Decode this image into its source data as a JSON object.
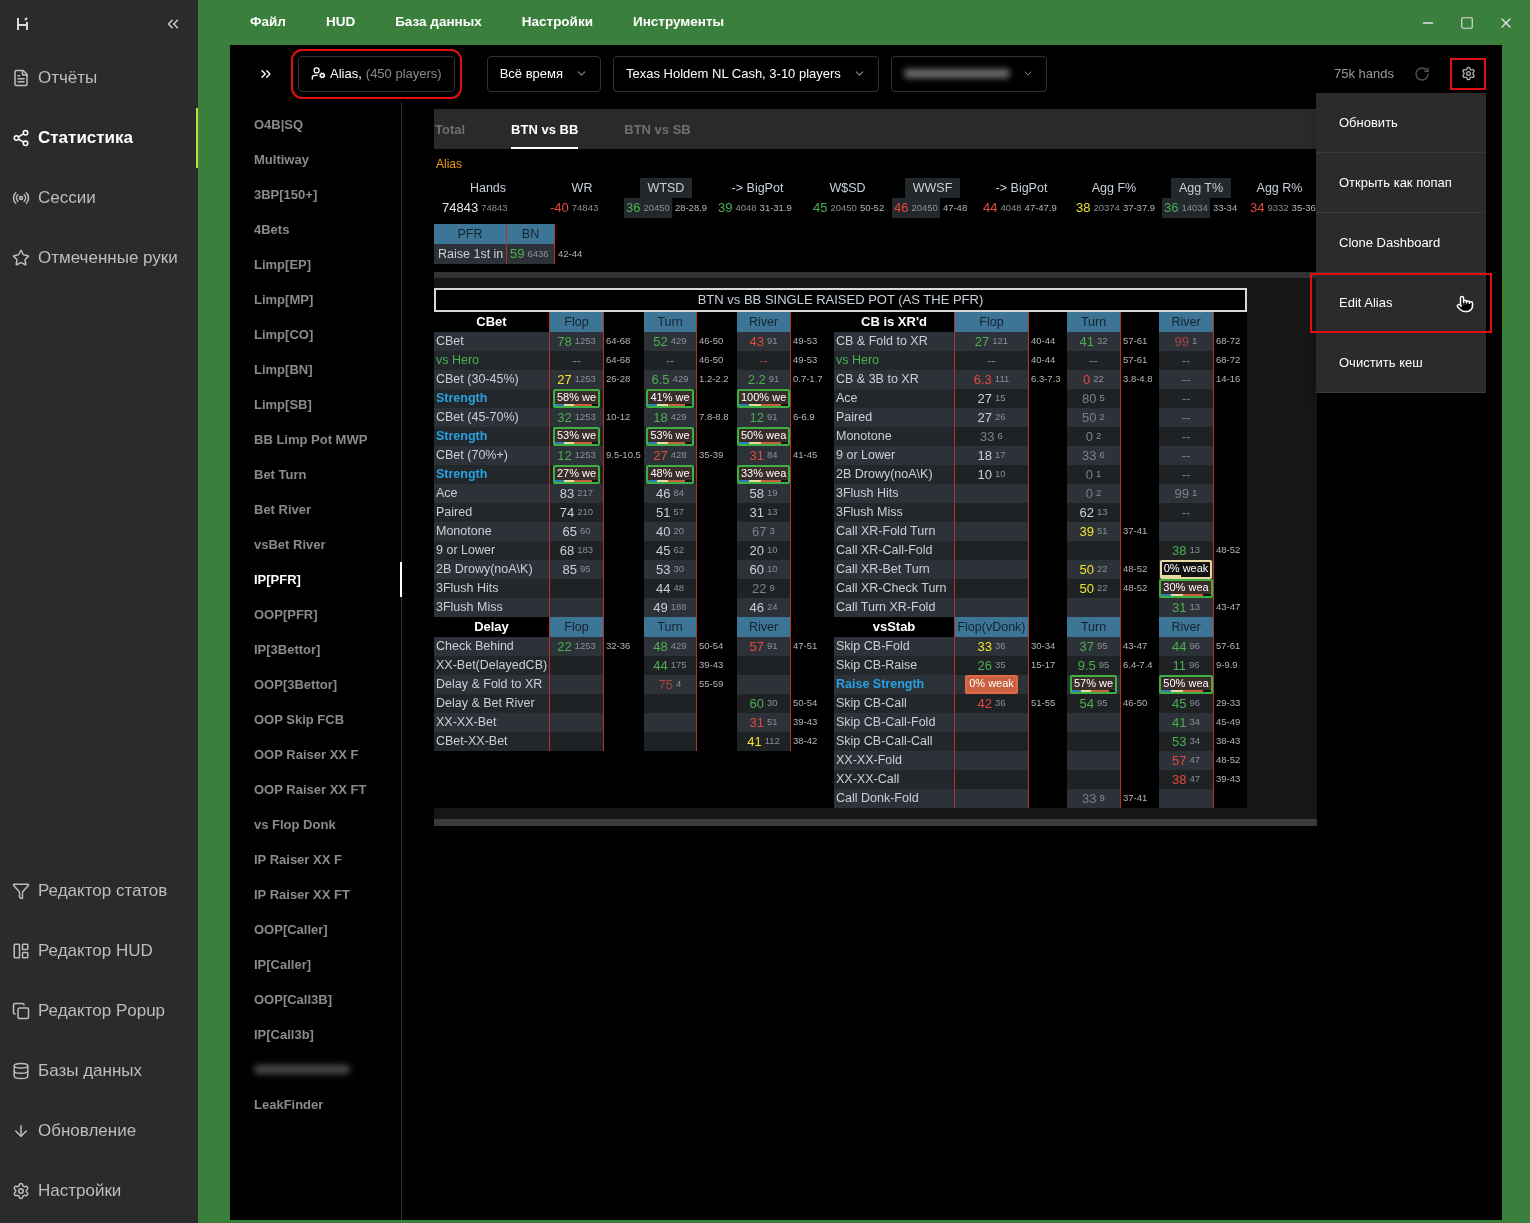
{
  "sidebar": {
    "top_items": [
      {
        "label": "Отчёты",
        "selected": false
      },
      {
        "label": "Статистика",
        "selected": true
      },
      {
        "label": "Сессии",
        "selected": false
      },
      {
        "label": "Отмеченные руки",
        "selected": false
      }
    ],
    "bottom_items": [
      {
        "label": "Редактор статов",
        "selected": false
      },
      {
        "label": "Редактор HUD",
        "selected": false
      },
      {
        "label": "Редактор Popup",
        "selected": false
      },
      {
        "label": "Базы данных",
        "selected": false
      },
      {
        "label": "Обновление",
        "selected": false
      },
      {
        "label": "Настройки",
        "selected": false
      }
    ]
  },
  "menu_bar": [
    "Файл",
    "HUD",
    "База данных",
    "Настройки",
    "Инструменты"
  ],
  "toolbar": {
    "alias_button": {
      "label": "Alias,",
      "count": "(450 players)",
      "highlighted": true
    },
    "dropdowns": [
      {
        "kind": "text",
        "value": "Всё время"
      },
      {
        "kind": "text",
        "value": "Texas Holdem NL Cash, 3-10 players"
      },
      {
        "kind": "blurred"
      }
    ],
    "hands": "75k hands",
    "settings_highlighted": true
  },
  "report_list": [
    {
      "kind": "text",
      "label": "O4B|SQ",
      "selected": false
    },
    {
      "kind": "text",
      "label": "Multiway",
      "selected": false
    },
    {
      "kind": "text",
      "label": "3BP[150+]",
      "selected": false
    },
    {
      "kind": "text",
      "label": "4Bets",
      "selected": false
    },
    {
      "kind": "text",
      "label": "Limp[EP]",
      "selected": false
    },
    {
      "kind": "text",
      "label": "Limp[MP]",
      "selected": false
    },
    {
      "kind": "text",
      "label": "Limp[CO]",
      "selected": false
    },
    {
      "kind": "text",
      "label": "Limp[BN]",
      "selected": false
    },
    {
      "kind": "text",
      "label": "Limp[SB]",
      "selected": false
    },
    {
      "kind": "text",
      "label": "BB Limp Pot MWP",
      "selected": false
    },
    {
      "kind": "text",
      "label": "Bet Turn",
      "selected": false
    },
    {
      "kind": "text",
      "label": "Bet River",
      "selected": false
    },
    {
      "kind": "text",
      "label": "vsBet River",
      "selected": false
    },
    {
      "kind": "text",
      "label": "IP[PFR]",
      "selected": true
    },
    {
      "kind": "text",
      "label": "OOP[PFR]",
      "selected": false
    },
    {
      "kind": "text",
      "label": "IP[3Bettor]",
      "selected": false
    },
    {
      "kind": "text",
      "label": "OOP[3Bettor]",
      "selected": false
    },
    {
      "kind": "text",
      "label": "OOP Skip FCB",
      "selected": false
    },
    {
      "kind": "text",
      "label": "OOP Raiser XX F",
      "selected": false
    },
    {
      "kind": "text",
      "label": "OOP Raiser XX FT",
      "selected": false
    },
    {
      "kind": "text",
      "label": "vs Flop Donk",
      "selected": false
    },
    {
      "kind": "text",
      "label": "IP Raiser XX F",
      "selected": false
    },
    {
      "kind": "text",
      "label": "IP Raiser XX FT",
      "selected": false
    },
    {
      "kind": "text",
      "label": "OOP[Caller]",
      "selected": false
    },
    {
      "kind": "text",
      "label": "IP[Caller]",
      "selected": false
    },
    {
      "kind": "text",
      "label": "OOP[Call3B]",
      "selected": false
    },
    {
      "kind": "text",
      "label": "IP[Call3b]",
      "selected": false
    },
    {
      "kind": "blurred",
      "selected": false
    },
    {
      "kind": "text",
      "label": "LeakFinder",
      "selected": false
    }
  ],
  "tabs": [
    {
      "label": "Total",
      "selected": false
    },
    {
      "label": "BTN vs BB",
      "selected": true
    },
    {
      "label": "BTN vs SB",
      "selected": false
    }
  ],
  "stats_header": {
    "group_label": "Alias",
    "stats": [
      {
        "name": "Hands",
        "highlighted": false,
        "v": "74843",
        "n": "74843",
        "color": "#e8e8e8"
      },
      {
        "name": "WR",
        "highlighted": false,
        "v": "-40",
        "n": "74843",
        "color": "#e5483b"
      },
      {
        "name": "WTSD",
        "highlighted": true,
        "v": "36",
        "n": "20450",
        "color": "#4caf50",
        "range": "28-28.9"
      },
      {
        "name": "-> BigPot",
        "highlighted": false,
        "v": "39",
        "n": "4048",
        "color": "#4caf50",
        "range": "31-31.9"
      },
      {
        "name": "W$SD",
        "highlighted": false,
        "v": "45",
        "n": "20450",
        "color": "#4caf50",
        "range": "50-52"
      },
      {
        "name": "WWSF",
        "highlighted": true,
        "v": "46",
        "n": "20450",
        "color": "#e5483b",
        "range": "47-48"
      },
      {
        "name": "-> BigPot",
        "highlighted": false,
        "v": "44",
        "n": "4048",
        "color": "#e5483b",
        "range": "47-47.9"
      },
      {
        "name": "Agg F%",
        "highlighted": false,
        "v": "38",
        "n": "20374",
        "color": "#f2e22a",
        "range": "37-37.9"
      },
      {
        "name": "Agg T%",
        "highlighted": true,
        "v": "36",
        "n": "14034",
        "color": "#4caf50",
        "range": "33-34"
      },
      {
        "name": "Agg R%",
        "highlighted": false,
        "v": "34",
        "n": "9332",
        "color": "#e5483b",
        "range": "35-36"
      }
    ]
  },
  "pfr_table": {
    "headers": [
      "PFR",
      "BN"
    ],
    "label": "Raise 1st in",
    "v": "59",
    "n": "6436",
    "color": "#4caf50",
    "range": "42-44"
  },
  "table": {
    "title": "BTN vs BB SINGLE RAISED POT (AS THE PFR)",
    "rows": [
      {
        "left": {
          "kind": "header",
          "title": "CBet",
          "streets": [
            "Flop",
            "Turn",
            "River"
          ]
        },
        "right": {
          "kind": "header",
          "title": "CB is XR'd",
          "streets": [
            "Flop",
            "Turn",
            "River"
          ]
        }
      },
      {
        "left": {
          "kind": "stat",
          "label": "CBet",
          "color": "#c8d0d8",
          "bold": false,
          "cells": [
            {
              "kind": "value",
              "v": "78",
              "n": "1253",
              "color": "#4caf50",
              "range": "64-68"
            },
            {
              "kind": "value",
              "v": "52",
              "n": "429",
              "color": "#4caf50",
              "range": "46-50"
            },
            {
              "kind": "value",
              "v": "43",
              "n": "91",
              "color": "#e5483b",
              "range": "49-53"
            }
          ]
        },
        "right": {
          "kind": "stat",
          "label": "CB & Fold to XR",
          "color": "#c8d0d8",
          "bold": false,
          "cells": [
            {
              "kind": "value",
              "v": "27",
              "n": "121",
              "color": "#4caf50",
              "range": "40-44"
            },
            {
              "kind": "value",
              "v": "41",
              "n": "32",
              "color": "#4caf50",
              "range": "57-61"
            },
            {
              "kind": "value",
              "v": "99",
              "n": "1",
              "color": "#a8453c",
              "range": "68-72"
            }
          ]
        }
      },
      {
        "left": {
          "kind": "stat",
          "label": "vs Hero",
          "color": "#4caf50",
          "bold": false,
          "cells": [
            {
              "kind": "value",
              "v": "--",
              "color": "#7a8187",
              "range": "64-68"
            },
            {
              "kind": "value",
              "v": "--",
              "color": "#7a8187",
              "range": "46-50"
            },
            {
              "kind": "value",
              "v": "--",
              "color": "#a8453c",
              "range": "49-53"
            }
          ]
        },
        "right": {
          "kind": "stat",
          "label": "vs Hero",
          "color": "#4caf50",
          "bold": false,
          "cells": [
            {
              "kind": "value",
              "v": "--",
              "color": "#7a8187",
              "range": "40-44"
            },
            {
              "kind": "value",
              "v": "--",
              "color": "#7a8187",
              "range": "57-61"
            },
            {
              "kind": "value",
              "v": "--",
              "color": "#7a8187",
              "range": "68-72"
            }
          ]
        }
      },
      {
        "left": {
          "kind": "stat",
          "label": "CBet (30-45%)",
          "color": "#c8d0d8",
          "bold": false,
          "cells": [
            {
              "kind": "value",
              "v": "27",
              "n": "1253",
              "color": "#f2e22a",
              "range": "26-28"
            },
            {
              "kind": "value",
              "v": "6.5",
              "n": "429",
              "color": "#4caf50",
              "range": "1.2-2.2"
            },
            {
              "kind": "value",
              "v": "2.2",
              "n": "91",
              "color": "#4caf50",
              "range": "0.7-1.7"
            }
          ]
        },
        "right": {
          "kind": "stat",
          "label": "CB & 3B to XR",
          "color": "#c8d0d8",
          "bold": false,
          "cells": [
            {
              "kind": "value",
              "v": "6.3",
              "n": "111",
              "color": "#e5483b",
              "range": "6.3-7.3"
            },
            {
              "kind": "value",
              "v": "0",
              "n": "22",
              "color": "#e5483b",
              "range": "3.8-4.8"
            },
            {
              "kind": "value",
              "v": "--",
              "color": "#7a8187",
              "range": "14-16"
            }
          ]
        }
      },
      {
        "left": {
          "kind": "stat",
          "label": "Strength",
          "color": "#2aa0e0",
          "bold": true,
          "cells": [
            {
              "kind": "striped-bar",
              "text": "58% we",
              "color": "#3cb043"
            },
            {
              "kind": "striped-bar",
              "text": "41% we",
              "color": "#3cb043"
            },
            {
              "kind": "striped-bar",
              "text": "100% we",
              "color": "#3cb043"
            }
          ]
        },
        "right": {
          "kind": "stat",
          "label": "Ace",
          "color": "#c8d0d8",
          "bold": false,
          "cells": [
            {
              "kind": "value",
              "v": "27",
              "n": "15",
              "color": "#c8d0d8"
            },
            {
              "kind": "value",
              "v": "80",
              "n": "5",
              "color": "#7a8187"
            },
            {
              "kind": "value",
              "v": "--",
              "color": "#7a8187"
            }
          ]
        }
      },
      {
        "left": {
          "kind": "stat",
          "label": "CBet (45-70%)",
          "color": "#c8d0d8",
          "bold": false,
          "cells": [
            {
              "kind": "value",
              "v": "32",
              "n": "1253",
              "color": "#4caf50",
              "range": "10-12"
            },
            {
              "kind": "value",
              "v": "18",
              "n": "429",
              "color": "#4caf50",
              "range": "7.8-8.8"
            },
            {
              "kind": "value",
              "v": "12",
              "n": "91",
              "color": "#4caf50",
              "range": "6-6.9"
            }
          ]
        },
        "right": {
          "kind": "stat",
          "label": "Paired",
          "color": "#c8d0d8",
          "bold": false,
          "cells": [
            {
              "kind": "value",
              "v": "27",
              "n": "26",
              "color": "#c8d0d8"
            },
            {
              "kind": "value",
              "v": "50",
              "n": "2",
              "color": "#7a8187"
            },
            {
              "kind": "value",
              "v": "--",
              "color": "#7a8187"
            }
          ]
        }
      },
      {
        "left": {
          "kind": "stat",
          "label": "Strength",
          "color": "#2aa0e0",
          "bold": true,
          "cells": [
            {
              "kind": "striped-bar",
              "text": "53% we",
              "color": "#3cb043"
            },
            {
              "kind": "striped-bar",
              "text": "53% we",
              "color": "#3cb043"
            },
            {
              "kind": "striped-bar",
              "text": "50% wea",
              "color": "#3cb043"
            }
          ]
        },
        "right": {
          "kind": "stat",
          "label": "Monotone",
          "color": "#c8d0d8",
          "bold": false,
          "cells": [
            {
              "kind": "value",
              "v": "33",
              "n": "6",
              "color": "#7a8187"
            },
            {
              "kind": "value",
              "v": "0",
              "n": "2",
              "color": "#7a8187"
            },
            {
              "kind": "value",
              "v": "--",
              "color": "#7a8187"
            }
          ]
        }
      },
      {
        "left": {
          "kind": "stat",
          "label": "CBet (70%+)",
          "color": "#c8d0d8",
          "bold": false,
          "cells": [
            {
              "kind": "value",
              "v": "12",
              "n": "1253",
              "color": "#4caf50",
              "range": "9.5-10.5"
            },
            {
              "kind": "value",
              "v": "27",
              "n": "428",
              "color": "#e5483b",
              "range": "35-39"
            },
            {
              "kind": "value",
              "v": "31",
              "n": "84",
              "color": "#e5483b",
              "range": "41-45"
            }
          ]
        },
        "right": {
          "kind": "stat",
          "label": "9 or Lower",
          "color": "#c8d0d8",
          "bold": false,
          "cells": [
            {
              "kind": "value",
              "v": "18",
              "n": "17",
              "color": "#c8d0d8"
            },
            {
              "kind": "value",
              "v": "33",
              "n": "6",
              "color": "#7a8187"
            },
            {
              "kind": "value",
              "v": "--",
              "color": "#7a8187"
            }
          ]
        }
      },
      {
        "left": {
          "kind": "stat",
          "label": "Strength",
          "color": "#2aa0e0",
          "bold": true,
          "cells": [
            {
              "kind": "striped-bar",
              "text": "27% we",
              "color": "#3cb043"
            },
            {
              "kind": "striped-bar",
              "text": "48% we",
              "color": "#3cb043"
            },
            {
              "kind": "striped-bar",
              "text": "33% wea",
              "color": "#3cb043"
            }
          ]
        },
        "right": {
          "kind": "stat",
          "label": "2B Drowy(noA\\K)",
          "color": "#c8d0d8",
          "bold": false,
          "cells": [
            {
              "kind": "value",
              "v": "10",
              "n": "10",
              "color": "#c8d0d8"
            },
            {
              "kind": "value",
              "v": "0",
              "n": "1",
              "color": "#7a8187"
            },
            {
              "kind": "value",
              "v": "--",
              "color": "#7a8187"
            }
          ]
        }
      },
      {
        "left": {
          "kind": "stat",
          "label": "Ace",
          "color": "#c8d0d8",
          "bold": false,
          "cells": [
            {
              "kind": "value",
              "v": "83",
              "n": "217",
              "color": "#c8d0d8"
            },
            {
              "kind": "value",
              "v": "46",
              "n": "84",
              "color": "#c8d0d8"
            },
            {
              "kind": "value",
              "v": "58",
              "n": "19",
              "color": "#c8d0d8"
            }
          ]
        },
        "right": {
          "kind": "stat",
          "label": "3Flush Hits",
          "color": "#c8d0d8",
          "bold": false,
          "cells": [
            null,
            {
              "kind": "value",
              "v": "0",
              "n": "2",
              "color": "#7a8187"
            },
            {
              "kind": "value",
              "v": "99",
              "n": "1",
              "color": "#7a8187"
            }
          ]
        }
      },
      {
        "left": {
          "kind": "stat",
          "label": "Paired",
          "color": "#c8d0d8",
          "bold": false,
          "cells": [
            {
              "kind": "value",
              "v": "74",
              "n": "210",
              "color": "#c8d0d8"
            },
            {
              "kind": "value",
              "v": "51",
              "n": "57",
              "color": "#c8d0d8"
            },
            {
              "kind": "value",
              "v": "31",
              "n": "13",
              "color": "#c8d0d8"
            }
          ]
        },
        "right": {
          "kind": "stat",
          "label": "3Flush Miss",
          "color": "#c8d0d8",
          "bold": false,
          "cells": [
            null,
            {
              "kind": "value",
              "v": "62",
              "n": "13",
              "color": "#c8d0d8"
            },
            {
              "kind": "value",
              "v": "--",
              "color": "#7a8187"
            }
          ]
        }
      },
      {
        "left": {
          "kind": "stat",
          "label": "Monotone",
          "color": "#c8d0d8",
          "bold": false,
          "cells": [
            {
              "kind": "value",
              "v": "65",
              "n": "60",
              "color": "#c8d0d8"
            },
            {
              "kind": "value",
              "v": "40",
              "n": "20",
              "color": "#c8d0d8"
            },
            {
              "kind": "value",
              "v": "67",
              "n": "3",
              "color": "#7a8187"
            }
          ]
        },
        "right": {
          "kind": "stat",
          "label": "Call XR-Fold Turn",
          "color": "#c8d0d8",
          "bold": false,
          "cells": [
            null,
            {
              "kind": "value",
              "v": "39",
              "n": "51",
              "color": "#f2e22a",
              "range": "37-41"
            },
            null
          ]
        }
      },
      {
        "left": {
          "kind": "stat",
          "label": "9 or Lower",
          "color": "#c8d0d8",
          "bold": false,
          "cells": [
            {
              "kind": "value",
              "v": "68",
              "n": "183",
              "color": "#c8d0d8"
            },
            {
              "kind": "value",
              "v": "45",
              "n": "62",
              "color": "#c8d0d8"
            },
            {
              "kind": "value",
              "v": "20",
              "n": "10",
              "color": "#c8d0d8"
            }
          ]
        },
        "right": {
          "kind": "stat",
          "label": "Call XR-Call-Fold",
          "color": "#c8d0d8",
          "bold": false,
          "cells": [
            null,
            null,
            {
              "kind": "value",
              "v": "38",
              "n": "13",
              "color": "#4caf50",
              "range": "48-52"
            }
          ]
        }
      },
      {
        "left": {
          "kind": "stat",
          "label": "2B Drowy(noA\\K)",
          "color": "#c8d0d8",
          "bold": false,
          "cells": [
            {
              "kind": "value",
              "v": "85",
              "n": "95",
              "color": "#c8d0d8"
            },
            {
              "kind": "value",
              "v": "53",
              "n": "30",
              "color": "#c8d0d8"
            },
            {
              "kind": "value",
              "v": "60",
              "n": "10",
              "color": "#c8d0d8"
            }
          ]
        },
        "right": {
          "kind": "stat",
          "label": "Call XR-Bet Turn",
          "color": "#c8d0d8",
          "bold": false,
          "cells": [
            null,
            {
              "kind": "value",
              "v": "50",
              "n": "22",
              "color": "#f2e22a",
              "range": "48-52"
            },
            {
              "kind": "partial-bar",
              "text": "0% weak",
              "color": "#e8d9a0"
            }
          ]
        }
      },
      {
        "left": {
          "kind": "stat",
          "label": "3Flush Hits",
          "color": "#c8d0d8",
          "bold": false,
          "cells": [
            null,
            {
              "kind": "value",
              "v": "44",
              "n": "48",
              "color": "#c8d0d8"
            },
            {
              "kind": "value",
              "v": "22",
              "n": "9",
              "color": "#7a8187"
            }
          ]
        },
        "right": {
          "kind": "stat",
          "label": "Call XR-Check Turn",
          "color": "#c8d0d8",
          "bold": false,
          "cells": [
            null,
            {
              "kind": "value",
              "v": "50",
              "n": "22",
              "color": "#f2e22a",
              "range": "48-52"
            },
            {
              "kind": "striped-bar",
              "text": "30% wea",
              "color": "#3cb043"
            }
          ]
        }
      },
      {
        "left": {
          "kind": "stat",
          "label": "3Flush Miss",
          "color": "#c8d0d8",
          "bold": false,
          "cells": [
            null,
            {
              "kind": "value",
              "v": "49",
              "n": "188",
              "color": "#c8d0d8"
            },
            {
              "kind": "value",
              "v": "46",
              "n": "24",
              "color": "#c8d0d8"
            }
          ]
        },
        "right": {
          "kind": "stat",
          "label": "Call Turn XR-Fold",
          "color": "#c8d0d8",
          "bold": false,
          "cells": [
            null,
            null,
            {
              "kind": "value",
              "v": "31",
              "n": "13",
              "color": "#4caf50",
              "range": "43-47"
            }
          ]
        }
      },
      {
        "left": {
          "kind": "header",
          "title": "Delay",
          "streets": [
            "Flop",
            "Turn",
            "River"
          ]
        },
        "right": {
          "kind": "header",
          "title": "vsStab",
          "streets": [
            "Flop(vDonk)",
            "Turn",
            "River"
          ]
        }
      },
      {
        "left": {
          "kind": "stat",
          "label": "Check Behind",
          "color": "#c8d0d8",
          "bold": false,
          "cells": [
            {
              "kind": "value",
              "v": "22",
              "n": "1253",
              "color": "#4caf50",
              "range": "32-36"
            },
            {
              "kind": "value",
              "v": "48",
              "n": "429",
              "color": "#4caf50",
              "range": "50-54"
            },
            {
              "kind": "value",
              "v": "57",
              "n": "91",
              "color": "#e5483b",
              "range": "47-51"
            }
          ]
        },
        "right": {
          "kind": "stat",
          "label": "Skip CB-Fold",
          "color": "#c8d0d8",
          "bold": false,
          "cells": [
            {
              "kind": "value",
              "v": "33",
              "n": "36",
              "color": "#f2e22a",
              "range": "30-34"
            },
            {
              "kind": "value",
              "v": "37",
              "n": "95",
              "color": "#4caf50",
              "range": "43-47"
            },
            {
              "kind": "value",
              "v": "44",
              "n": "96",
              "color": "#4caf50",
              "range": "57-61"
            }
          ]
        }
      },
      {
        "left": {
          "kind": "stat",
          "label": "XX-Bet(DelayedCB)",
          "color": "#c8d0d8",
          "bold": false,
          "cells": [
            null,
            {
              "kind": "value",
              "v": "44",
              "n": "175",
              "color": "#4caf50",
              "range": "39-43"
            },
            null
          ]
        },
        "right": {
          "kind": "stat",
          "label": "Skip CB-Raise",
          "color": "#c8d0d8",
          "bold": false,
          "cells": [
            {
              "kind": "value",
              "v": "26",
              "n": "35",
              "color": "#4caf50",
              "range": "15-17"
            },
            {
              "kind": "value",
              "v": "9.5",
              "n": "95",
              "color": "#4caf50",
              "range": "6.4-7.4"
            },
            {
              "kind": "value",
              "v": "11",
              "n": "96",
              "color": "#4caf50",
              "range": "9-9.9"
            }
          ]
        }
      },
      {
        "left": {
          "kind": "stat",
          "label": "Delay & Fold to XR",
          "color": "#c8d0d8",
          "bold": false,
          "cells": [
            null,
            {
              "kind": "value",
              "v": "75",
              "n": "4",
              "color": "#a8453c",
              "range": "55-59"
            },
            null
          ]
        },
        "right": {
          "kind": "stat",
          "label": "Raise Strength",
          "color": "#2aa0e0",
          "bold": true,
          "cells": [
            {
              "kind": "solid-bar",
              "text": "0% weak",
              "color": "#e06a45"
            },
            {
              "kind": "striped-bar",
              "text": "57% we",
              "color": "#3cb043"
            },
            {
              "kind": "striped-bar",
              "text": "50% wea",
              "color": "#3cb043"
            }
          ]
        }
      },
      {
        "left": {
          "kind": "stat",
          "label": "Delay & Bet River",
          "color": "#c8d0d8",
          "bold": false,
          "cells": [
            null,
            null,
            {
              "kind": "value",
              "v": "60",
              "n": "30",
              "color": "#4caf50",
              "range": "50-54"
            }
          ]
        },
        "right": {
          "kind": "stat",
          "label": "Skip CB-Call",
          "color": "#c8d0d8",
          "bold": false,
          "cells": [
            {
              "kind": "value",
              "v": "42",
              "n": "36",
              "color": "#e5483b",
              "range": "51-55"
            },
            {
              "kind": "value",
              "v": "54",
              "n": "95",
              "color": "#4caf50",
              "range": "46-50"
            },
            {
              "kind": "value",
              "v": "45",
              "n": "96",
              "color": "#4caf50",
              "range": "29-33"
            }
          ]
        }
      },
      {
        "left": {
          "kind": "stat",
          "label": "XX-XX-Bet",
          "color": "#c8d0d8",
          "bold": false,
          "cells": [
            null,
            null,
            {
              "kind": "value",
              "v": "31",
              "n": "51",
              "color": "#e5483b",
              "range": "39-43"
            }
          ]
        },
        "right": {
          "kind": "stat",
          "label": "Skip CB-Call-Fold",
          "color": "#c8d0d8",
          "bold": false,
          "cells": [
            null,
            null,
            {
              "kind": "value",
              "v": "41",
              "n": "34",
              "color": "#4caf50",
              "range": "45-49"
            }
          ]
        }
      },
      {
        "left": {
          "kind": "stat",
          "label": "CBet-XX-Bet",
          "color": "#c8d0d8",
          "bold": false,
          "cells": [
            null,
            null,
            {
              "kind": "value",
              "v": "41",
              "n": "112",
              "color": "#f2e22a",
              "range": "38-42"
            }
          ]
        },
        "right": {
          "kind": "stat",
          "label": "Skip CB-Call-Call",
          "color": "#c8d0d8",
          "bold": false,
          "cells": [
            null,
            null,
            {
              "kind": "value",
              "v": "53",
              "n": "34",
              "color": "#4caf50",
              "range": "38-43"
            }
          ]
        }
      },
      {
        "right": {
          "kind": "stat",
          "label": "XX-XX-Fold",
          "color": "#c8d0d8",
          "bold": false,
          "cells": [
            null,
            null,
            {
              "kind": "value",
              "v": "57",
              "n": "47",
              "color": "#e5483b",
              "range": "48-52"
            }
          ]
        }
      },
      {
        "right": {
          "kind": "stat",
          "label": "XX-XX-Call",
          "color": "#c8d0d8",
          "bold": false,
          "cells": [
            null,
            null,
            {
              "kind": "value",
              "v": "38",
              "n": "47",
              "color": "#e5483b",
              "range": "39-43"
            }
          ]
        }
      },
      {
        "right": {
          "kind": "stat",
          "label": "Call Donk-Fold",
          "color": "#c8d0d8",
          "bold": false,
          "cells": [
            null,
            {
              "kind": "value",
              "v": "33",
              "n": "9",
              "color": "#7a8187",
              "range": "37-41"
            },
            null
          ]
        }
      }
    ]
  },
  "settings_menu": [
    {
      "label": "Обновить",
      "highlighted": false
    },
    {
      "label": "Открыть как попап",
      "highlighted": false
    },
    {
      "label": "Clone Dashboard",
      "highlighted": false
    },
    {
      "label": "Edit Alias",
      "highlighted": true
    },
    {
      "label": "Очистить кеш",
      "highlighted": false
    }
  ]
}
